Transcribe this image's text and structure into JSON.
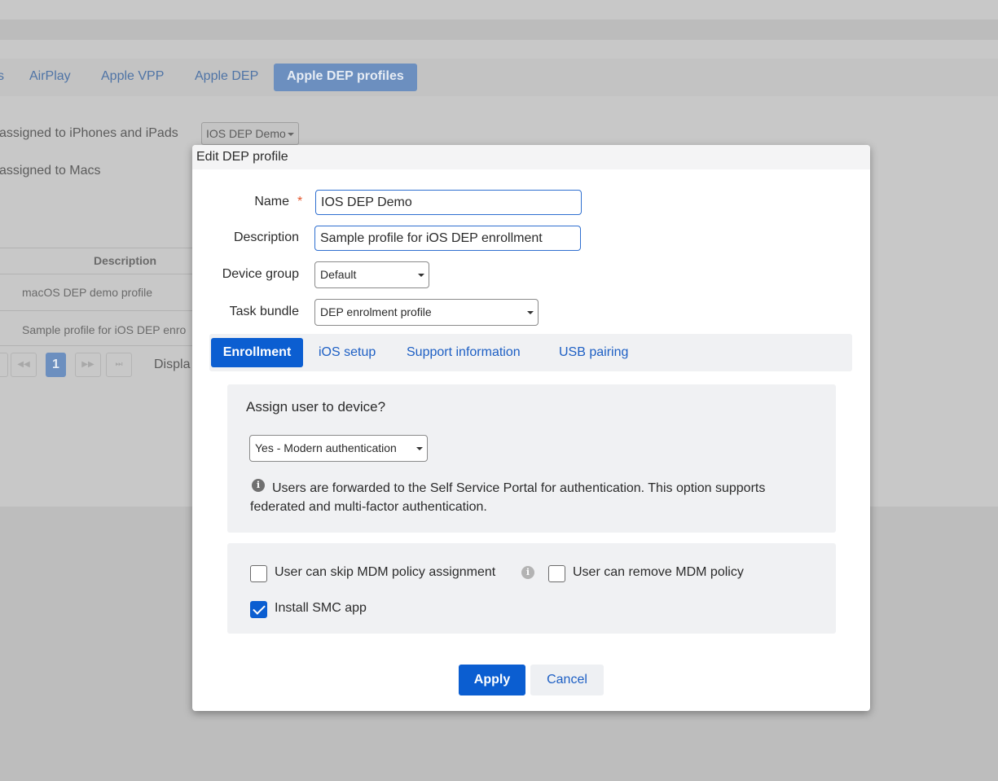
{
  "background": {
    "tabs": [
      "s",
      "AirPlay",
      "Apple VPP",
      "Apple DEP",
      "Apple DEP profiles"
    ],
    "iphone_label": "assigned to iPhones and iPads",
    "iphone_profile": "IOS DEP Demo",
    "mac_label": "assigned to Macs",
    "table_header_description": "Description",
    "rows": [
      "macOS DEP demo profile",
      "Sample profile for iOS DEP enro"
    ],
    "pager": {
      "first": "⏮",
      "prev": "◀◀",
      "current": "1",
      "next": "▶▶",
      "last": "⏭"
    },
    "display_text": "Displa"
  },
  "modal": {
    "title": "Edit DEP profile",
    "fields": {
      "name_label": "Name",
      "required_mark": "*",
      "name_value": "IOS DEP Demo",
      "description_label": "Description",
      "description_value": "Sample profile for iOS DEP enrollment",
      "device_group_label": "Device group",
      "device_group_value": "Default",
      "task_bundle_label": "Task bundle",
      "task_bundle_value": "DEP enrolment profile"
    },
    "tabs": [
      "Enrollment",
      "iOS setup",
      "Support information",
      "USB pairing"
    ],
    "active_tab": "Enrollment",
    "assign": {
      "title": "Assign user to device?",
      "selected": "Yes - Modern authentication",
      "info": "Users are forwarded to the Self Service Portal for authentication. This option supports federated and multi-factor authentication."
    },
    "options": {
      "skip_mdm_label": "User can skip MDM policy assignment",
      "skip_mdm_checked": false,
      "remove_mdm_label": "User can remove MDM policy",
      "remove_mdm_checked": false,
      "install_smc_label": "Install SMC app",
      "install_smc_checked": true
    },
    "buttons": {
      "apply": "Apply",
      "cancel": "Cancel"
    }
  },
  "colors": {
    "accent": "#0b5ed1",
    "link": "#1d5fc4",
    "required": "#e4572e",
    "overlay": "#bdbdbd"
  },
  "icons": [
    "info-icon",
    "caret-down-icon",
    "checkmark-icon"
  ]
}
